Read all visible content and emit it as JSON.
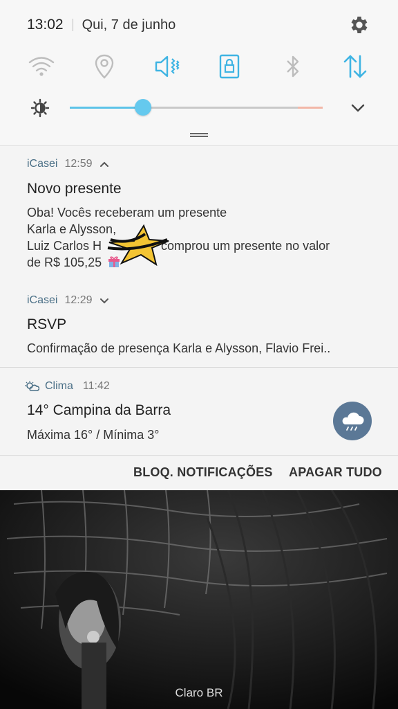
{
  "status": {
    "time": "13:02",
    "date": "Qui, 7 de junho"
  },
  "toggles": [
    {
      "name": "wifi",
      "icon": "wifi-icon",
      "active": false
    },
    {
      "name": "location",
      "icon": "location-icon",
      "active": false
    },
    {
      "name": "vibrate",
      "icon": "vibrate-icon",
      "active": true
    },
    {
      "name": "rotation-lock",
      "icon": "rotation-lock-icon",
      "active": true
    },
    {
      "name": "bluetooth",
      "icon": "bluetooth-icon",
      "active": false
    },
    {
      "name": "mobile-data",
      "icon": "data-arrows-icon",
      "active": true
    }
  ],
  "brightness": {
    "level_percent": 29
  },
  "notifications": [
    {
      "app": "iCasei",
      "time": "12:59",
      "title": "Novo presente",
      "lines": [
        "Oba! Vocês receberam um presente",
        "Karla e Alysson,",
        "Luiz Carlos H",
        "comprou um presente no valor",
        "de R$ 105,25"
      ]
    },
    {
      "app": "iCasei",
      "time": "12:29",
      "title": "RSVP",
      "body": "Confirmação de presença Karla e Alysson, Flavio Frei.."
    },
    {
      "app": "Clima",
      "time": "11:42",
      "title": "14° Campina da Barra",
      "body": "Máxima 16° / Mínima 3°"
    }
  ],
  "actions": {
    "block": "BLOQ. NOTIFICAÇÕES",
    "clear": "APAGAR TUDO"
  },
  "lockscreen": {
    "carrier": "Claro BR"
  },
  "colors": {
    "accent": "#3fb4e3",
    "inactive": "#bdbdbd",
    "weather_bg": "#5b7896"
  }
}
